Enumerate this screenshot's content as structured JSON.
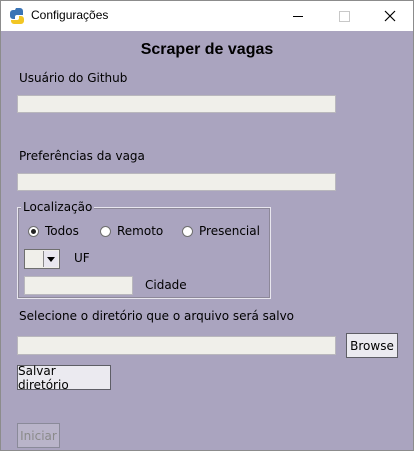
{
  "window": {
    "title": "Configurações",
    "controls": [
      "minimize",
      "maximize",
      "close"
    ]
  },
  "heading": "Scraper de vagas",
  "github": {
    "label": "Usuário do Github",
    "value": ""
  },
  "preferences": {
    "label": "Preferências da vaga",
    "value": ""
  },
  "location": {
    "group_label": "Localização",
    "options": [
      "Todos",
      "Remoto",
      "Presencial"
    ],
    "selected": "Todos",
    "uf_label": "UF",
    "uf_value": "",
    "city_label": "Cidade",
    "city_value": ""
  },
  "directory": {
    "label": "Selecione o diretório que o arquivo será salvo",
    "value": "",
    "browse_label": "Browse",
    "save_label": "Salvar diretório"
  },
  "start_label": "Iniciar",
  "colors": {
    "background": "#aaa4bf",
    "entry": "#f0efea"
  }
}
